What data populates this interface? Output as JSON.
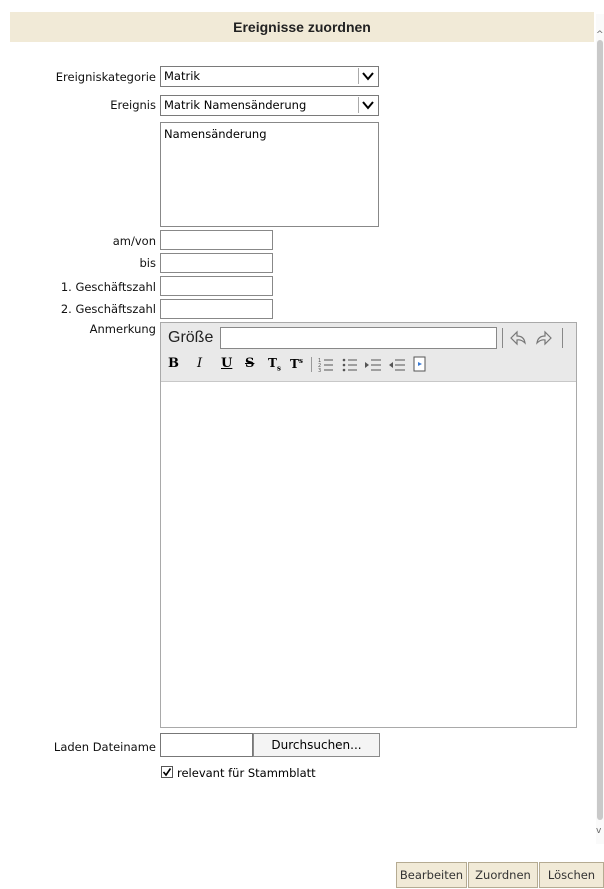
{
  "header": {
    "title": "Ereignisse zuordnen"
  },
  "form": {
    "kategorie_label": "Ereigniskategorie",
    "kategorie_value": "Matrik",
    "ereignis_label": "Ereignis",
    "ereignis_value": "Matrik Namensänderung",
    "beschreibung": "Namensänderung",
    "amvon_label": "am/von",
    "bis_label": "bis",
    "gz1_label": "1. Geschäftszahl",
    "gz2_label": "2. Geschäftszahl",
    "anmerkung_label": "Anmerkung",
    "datei_label": "Laden Dateiname",
    "browse_label": "Durchsuchen...",
    "relevant_label": "relevant für Stammblatt"
  },
  "editor": {
    "size_label": "Größe",
    "buttons": [
      "B",
      "I",
      "U",
      "S",
      "T",
      "T",
      "1",
      "≡",
      "⇤",
      "⇥",
      "⎘"
    ]
  },
  "footer": {
    "bearbeiten": "Bearbeiten",
    "zuordnen": "Zuordnen",
    "loeschen": "Löschen"
  }
}
